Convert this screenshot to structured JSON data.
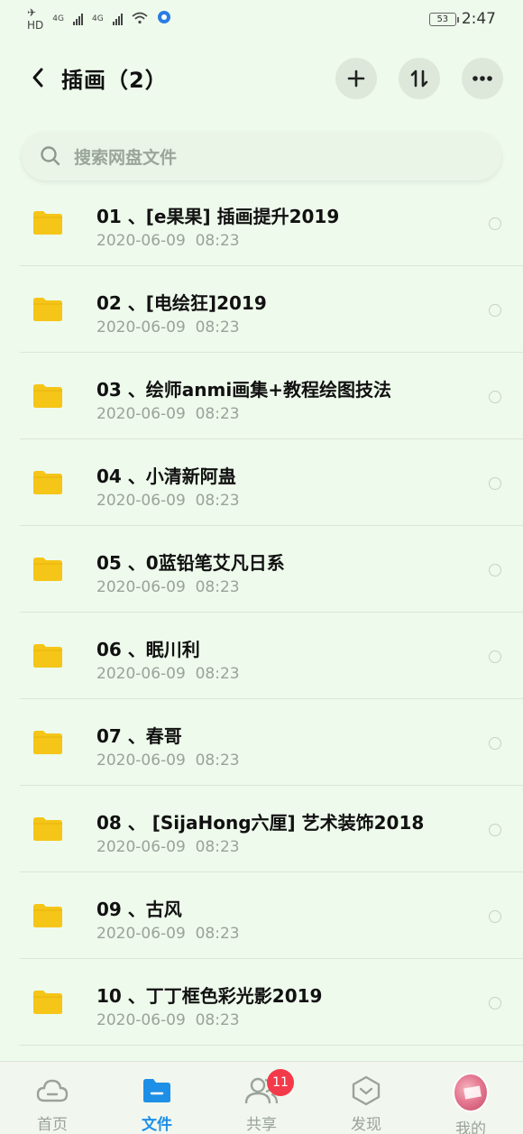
{
  "status_bar": {
    "hd_label": "HD",
    "net1": "4G",
    "net2": "4G",
    "battery": "53",
    "time": "2:47"
  },
  "header": {
    "title": "插画（2）"
  },
  "search": {
    "placeholder": "搜索网盘文件"
  },
  "files": [
    {
      "name": "01 、[e果果] 插画提升2019",
      "date": "2020-06-09  08:23"
    },
    {
      "name": "02 、[电绘狂]2019",
      "date": "2020-06-09  08:23"
    },
    {
      "name": "03 、绘师anmi画集+教程绘图技法",
      "date": "2020-06-09  08:23"
    },
    {
      "name": "04 、小清新阿蛊",
      "date": "2020-06-09  08:23"
    },
    {
      "name": "05 、0蓝铅笔艾凡日系",
      "date": "2020-06-09  08:23"
    },
    {
      "name": "06 、眠川利",
      "date": "2020-06-09  08:23"
    },
    {
      "name": "07 、春哥",
      "date": "2020-06-09  08:23"
    },
    {
      "name": "08 、 [SijaHong六厘] 艺术装饰2018",
      "date": "2020-06-09  08:23"
    },
    {
      "name": "09 、古风",
      "date": "2020-06-09  08:23"
    },
    {
      "name": "10 、丁丁框色彩光影2019",
      "date": "2020-06-09  08:23"
    }
  ],
  "bottom_nav": {
    "home": "首页",
    "files": "文件",
    "share": "共享",
    "share_badge": "11",
    "discover": "发现",
    "me": "我的"
  },
  "colors": {
    "background": "#eefaec",
    "folder": "#f5c518",
    "active": "#1e8fe6",
    "badge": "#f33a4a"
  }
}
